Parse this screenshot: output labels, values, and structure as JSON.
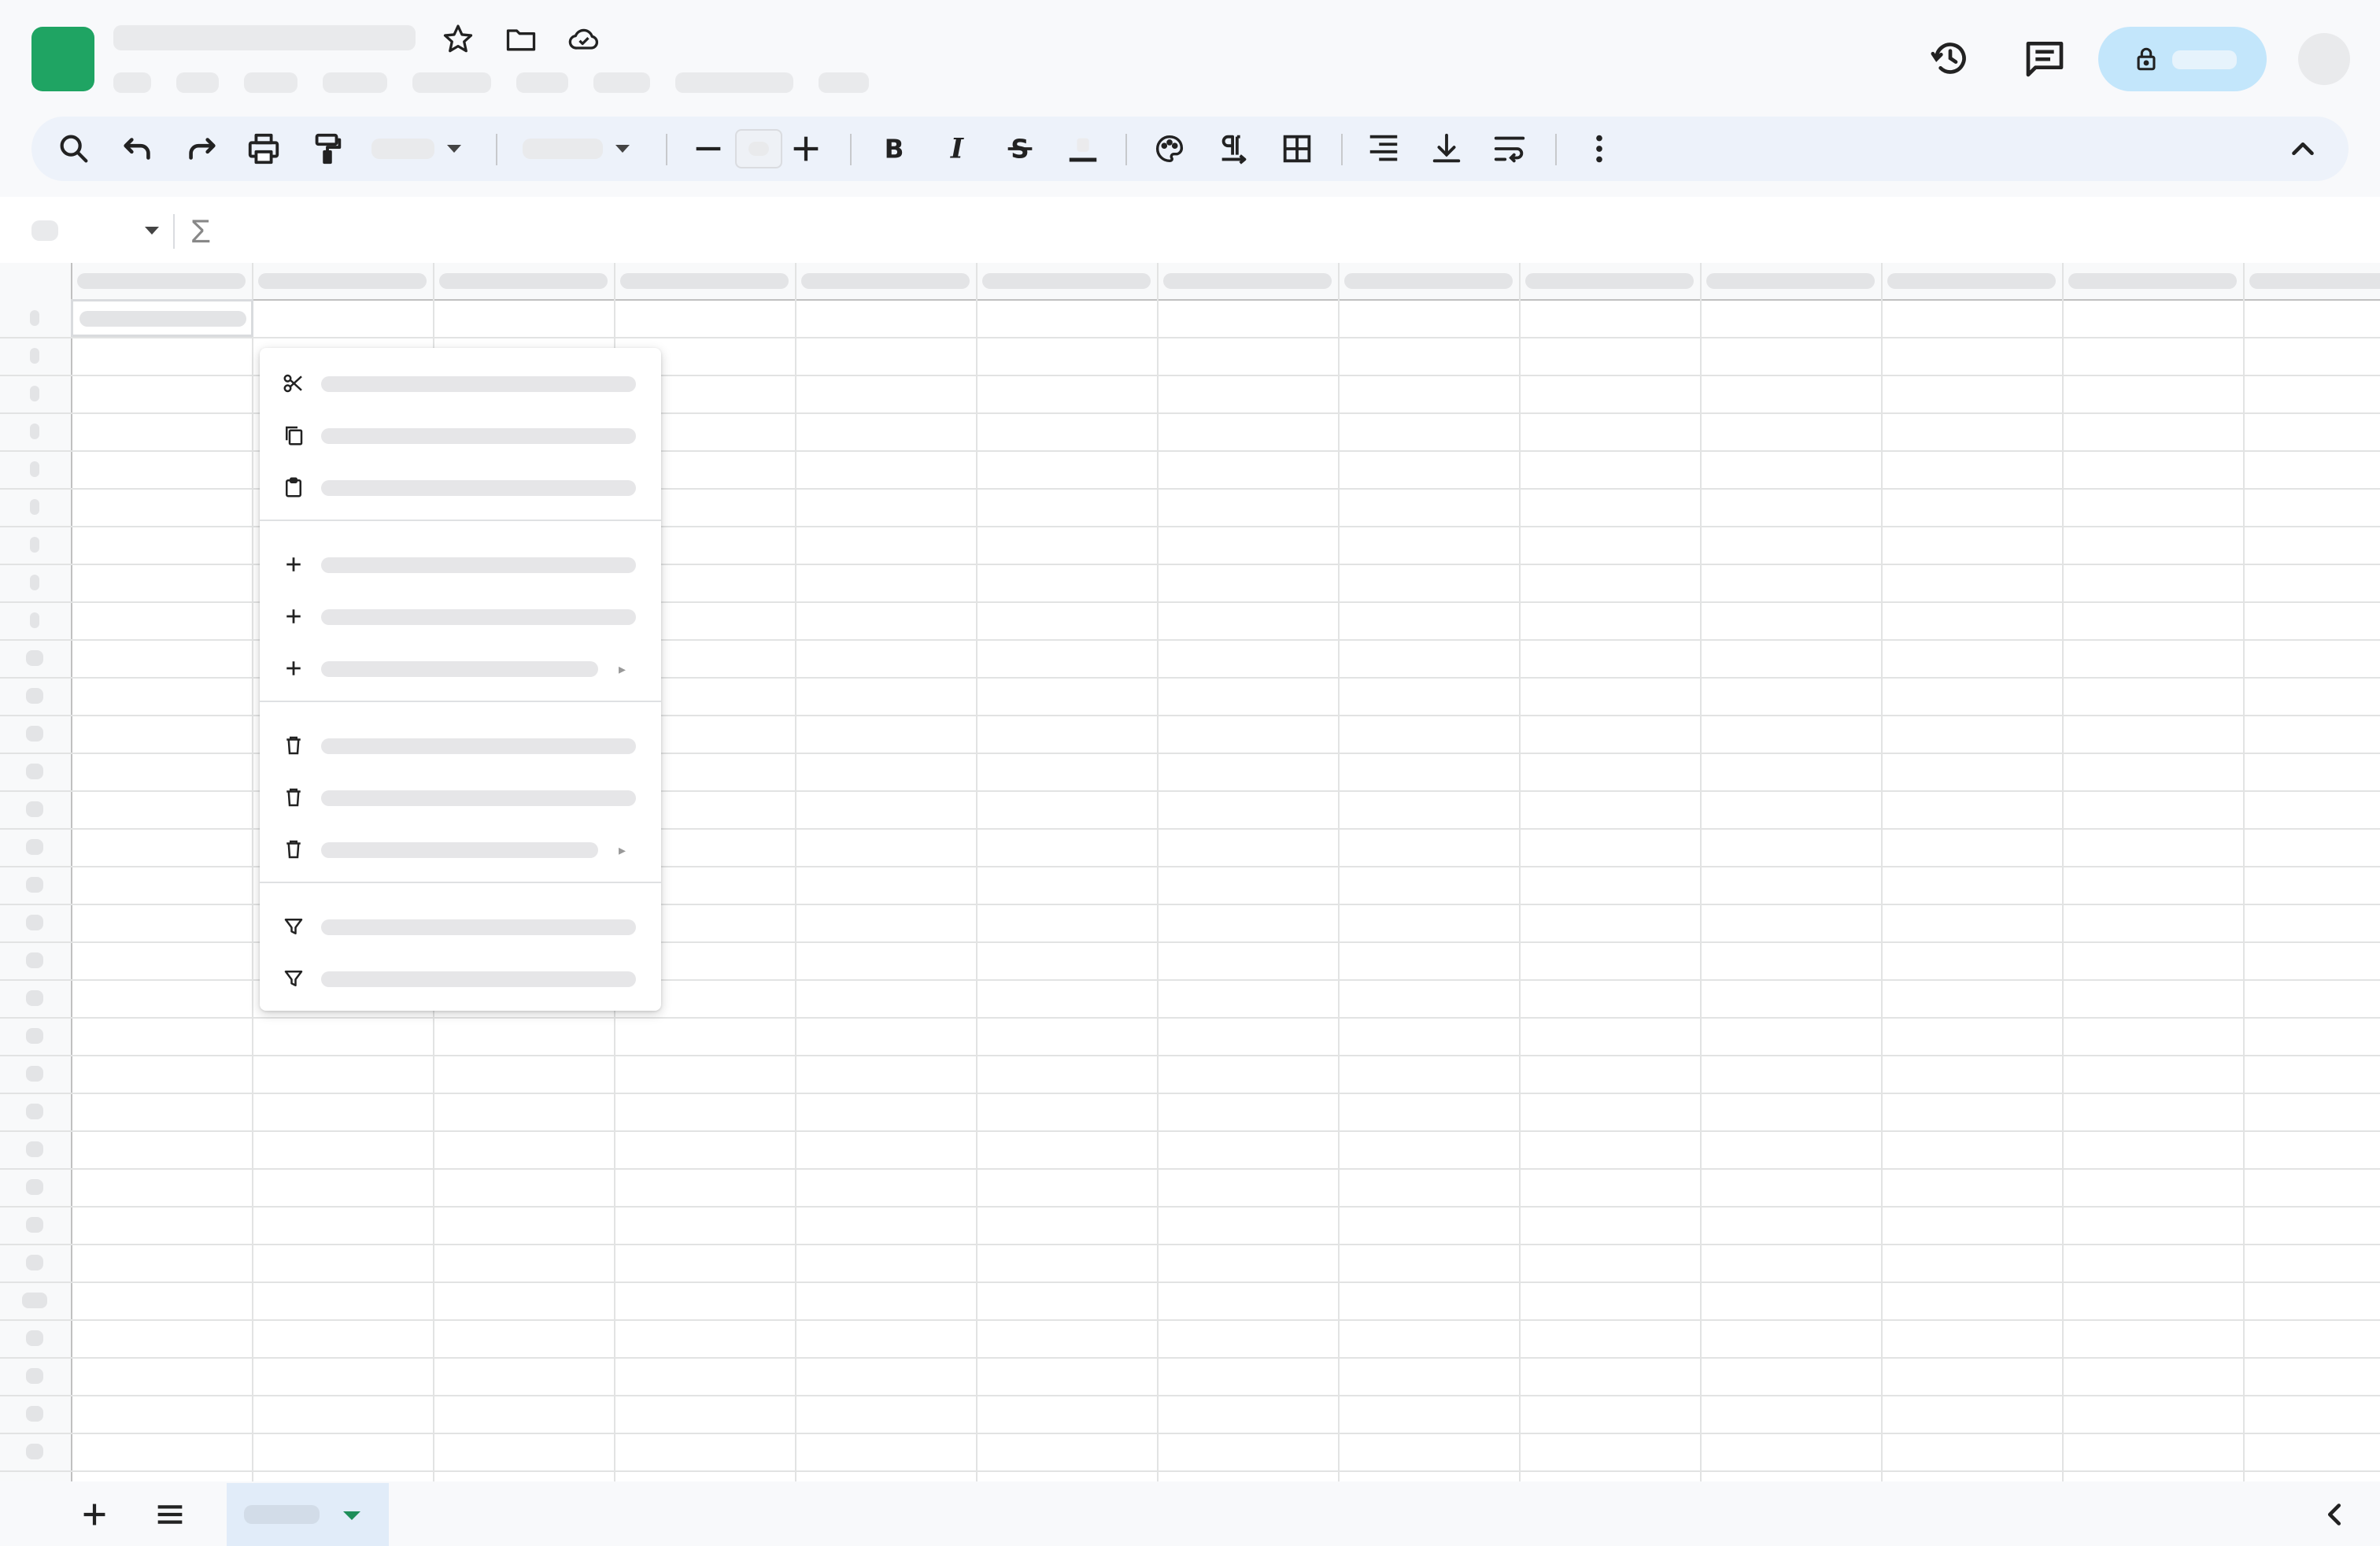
{
  "app": {
    "brand_color": "#1fa463",
    "accent_color": "#c3e6fb"
  },
  "header": {
    "title": "",
    "menus": [
      "",
      "",
      "",
      "",
      "",
      "",
      "",
      "",
      ""
    ],
    "icons": [
      "star-icon",
      "folder-icon",
      "cloud-saved-icon"
    ],
    "right_icons": [
      "history-icon",
      "comments-icon"
    ],
    "share_label": ""
  },
  "toolbar": {
    "buttons": [
      "search-icon",
      "undo-icon",
      "redo-icon",
      "print-icon",
      "paint-format-icon",
      "decrease-font-size-icon",
      "increase-font-size-icon",
      "bold-icon",
      "italic-icon",
      "strikethrough-icon",
      "text-color-icon",
      "fill-color-icon",
      "text-direction-icon",
      "borders-icon",
      "horizontal-align-icon",
      "vertical-align-icon",
      "text-wrap-icon",
      "more-options-icon",
      "collapse-toolbar-icon"
    ],
    "zoom_value": "",
    "font_family": "",
    "font_size": ""
  },
  "formula_bar": {
    "name_box": "",
    "function_symbol": "Σ",
    "formula": ""
  },
  "context_menu": {
    "groups": [
      [
        {
          "icon": "scissors-icon",
          "label": ""
        },
        {
          "icon": "copy-icon",
          "label": ""
        },
        {
          "icon": "paste-icon",
          "label": ""
        }
      ],
      [
        {
          "icon": "plus-icon",
          "label": ""
        },
        {
          "icon": "plus-icon",
          "label": ""
        },
        {
          "icon": "plus-icon",
          "label": "",
          "submenu": true
        }
      ],
      [
        {
          "icon": "trash-icon",
          "label": ""
        },
        {
          "icon": "trash-icon",
          "label": ""
        },
        {
          "icon": "trash-icon",
          "label": "",
          "submenu": true
        }
      ],
      [
        {
          "icon": "filter-icon",
          "label": ""
        },
        {
          "icon": "filter-icon",
          "label": ""
        }
      ]
    ]
  },
  "bottom_bar": {
    "sheet_tab_label": "",
    "icons": [
      "add-sheet-icon",
      "all-sheets-icon",
      "collapse-side-panel-icon"
    ]
  }
}
